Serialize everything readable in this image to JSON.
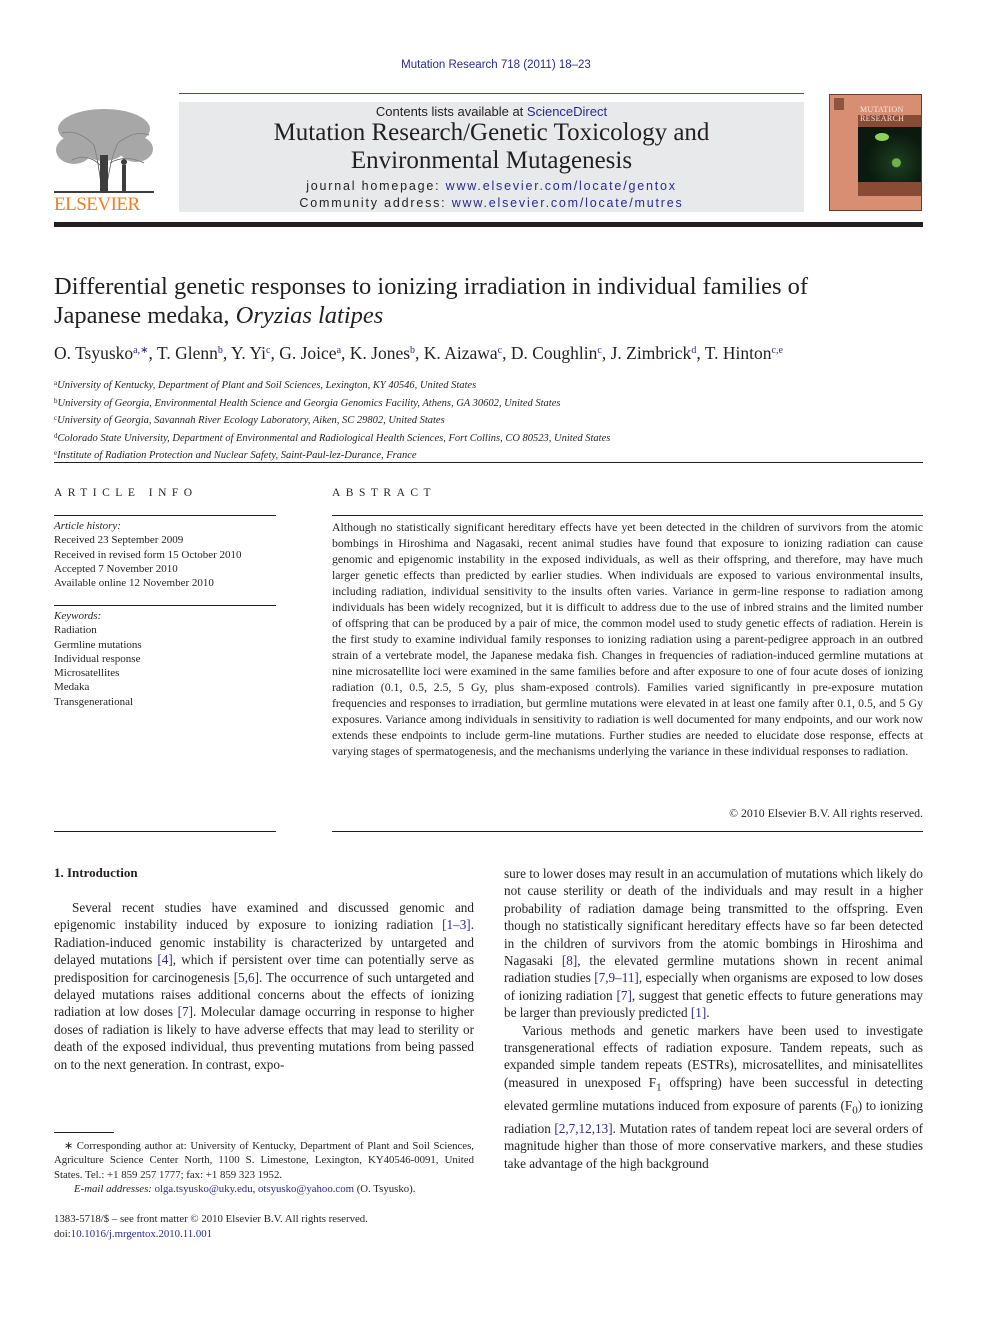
{
  "citation": "Mutation Research 718 (2011) 18–23",
  "header": {
    "publisher_logo_text": "ELSEVIER",
    "contents_prefix": "Contents lists available at ",
    "contents_link": "ScienceDirect",
    "journal_title_line1": "Mutation Research/Genetic Toxicology and",
    "journal_title_line2": "Environmental Mutagenesis",
    "homepage_label": "journal homepage: ",
    "homepage_url": "www.elsevier.com/locate/gentox",
    "community_label": "Community address: ",
    "community_url": "www.elsevier.com/locate/mutres",
    "cover_title_line1": "MUTATION",
    "cover_title_line2": "RESEARCH",
    "colors": {
      "elsevier_orange": "#f07f1f",
      "link_blue": "#2a2a8c",
      "banner_gray": "#e8e9ea",
      "cover_salmon": "#d88e72"
    }
  },
  "article": {
    "title_line1": "Differential genetic responses to ionizing irradiation in individual families of",
    "title_line2_plain": "Japanese medaka, ",
    "title_line2_italic": "Oryzias latipes",
    "authors": [
      {
        "name": "O. Tsyusko",
        "sup": "a,∗"
      },
      {
        "name": "T. Glenn",
        "sup": "b"
      },
      {
        "name": "Y. Yi",
        "sup": "c"
      },
      {
        "name": "G. Joice",
        "sup": "a"
      },
      {
        "name": "K. Jones",
        "sup": "b"
      },
      {
        "name": "K. Aizawa",
        "sup": "c"
      },
      {
        "name": "D. Coughlin",
        "sup": "c"
      },
      {
        "name": "J. Zimbrick",
        "sup": "d"
      },
      {
        "name": "T. Hinton",
        "sup": "c,e"
      }
    ],
    "affiliations": [
      {
        "key": "a",
        "text": "University of Kentucky, Department of Plant and Soil Sciences, Lexington, KY 40546, United States"
      },
      {
        "key": "b",
        "text": "University of Georgia, Environmental Health Science and Georgia Genomics Facility, Athens, GA 30602, United States"
      },
      {
        "key": "c",
        "text": "University of Georgia, Savannah River Ecology Laboratory, Aiken, SC 29802, United States"
      },
      {
        "key": "d",
        "text": "Colorado State University, Department of Environmental and Radiological Health Sciences, Fort Collins, CO 80523, United States"
      },
      {
        "key": "e",
        "text": "Institute of Radiation Protection and Nuclear Safety, Saint-Paul-lez-Durance, France"
      }
    ]
  },
  "article_info": {
    "heading": "ARTICLE INFO",
    "history_label": "Article history:",
    "history": [
      "Received 23 September 2009",
      "Received in revised form 15 October 2010",
      "Accepted 7 November 2010",
      "Available online 12 November 2010"
    ],
    "keywords_label": "Keywords:",
    "keywords": [
      "Radiation",
      "Germline mutations",
      "Individual response",
      "Microsatellites",
      "Medaka",
      "Transgenerational"
    ]
  },
  "abstract": {
    "heading": "ABSTRACT",
    "text": "Although no statistically significant hereditary effects have yet been detected in the children of survivors from the atomic bombings in Hiroshima and Nagasaki, recent animal studies have found that exposure to ionizing radiation can cause genomic and epigenomic instability in the exposed individuals, as well as their offspring, and therefore, may have much larger genetic effects than predicted by earlier studies. When individuals are exposed to various environmental insults, including radiation, individual sensitivity to the insults often varies. Variance in germ-line response to radiation among individuals has been widely recognized, but it is difficult to address due to the use of inbred strains and the limited number of offspring that can be produced by a pair of mice, the common model used to study genetic effects of radiation. Herein is the first study to examine individual family responses to ionizing radiation using a parent-pedigree approach in an outbred strain of a vertebrate model, the Japanese medaka fish. Changes in frequencies of radiation-induced germline mutations at nine microsatellite loci were examined in the same families before and after exposure to one of four acute doses of ionizing radiation (0.1, 0.5, 2.5, 5 Gy, plus sham-exposed controls). Families varied significantly in pre-exposure mutation frequencies and responses to irradiation, but germline mutations were elevated in at least one family after 0.1, 0.5, and 5 Gy exposures. Variance among individuals in sensitivity to radiation is well documented for many endpoints, and our work now extends these endpoints to include germ-line mutations. Further studies are needed to elucidate dose response, effects at varying stages of spermatogenesis, and the mechanisms underlying the variance in these individual responses to radiation.",
    "copyright": "© 2010 Elsevier B.V. All rights reserved."
  },
  "body": {
    "section_heading": "1.  Introduction",
    "left_para": [
      {
        "t": "Several recent studies have examined and discussed genomic and epigenomic instability induced by exposure to ionizing radiation "
      },
      {
        "ref": "[1–3]"
      },
      {
        "t": ". Radiation-induced genomic instability is characterized by untargeted and delayed mutations "
      },
      {
        "ref": "[4]"
      },
      {
        "t": ", which if persistent over time can potentially serve as predisposition for carcinogenesis "
      },
      {
        "ref": "[5,6]"
      },
      {
        "t": ". The occurrence of such untargeted and delayed mutations raises additional concerns about the effects of ionizing radiation at low doses "
      },
      {
        "ref": "[7]"
      },
      {
        "t": ". Molecular damage occurring in response to higher doses of radiation is likely to have adverse effects that may lead to sterility or death of the exposed individual, thus preventing mutations from being passed on to the next generation. In contrast, expo-"
      }
    ],
    "right_para1": [
      {
        "t": "sure to lower doses may result in an accumulation of mutations which likely do not cause sterility or death of the individuals and may result in a higher probability of radiation damage being transmitted to the offspring. Even though no statistically significant hereditary effects have so far been detected in the children of survivors from the atomic bombings in Hiroshima and Nagasaki "
      },
      {
        "ref": "[8]"
      },
      {
        "t": ", the elevated germline mutations shown in recent animal radiation studies "
      },
      {
        "ref": "[7,9–11]"
      },
      {
        "t": ", especially when organisms are exposed to low doses of ionizing radiation "
      },
      {
        "ref": "[7]"
      },
      {
        "t": ", suggest that genetic effects to future generations may be larger than previously predicted "
      },
      {
        "ref": "[1]"
      },
      {
        "t": "."
      }
    ],
    "right_para2": [
      {
        "t": "Various methods and genetic markers have been used to investigate transgenerational effects of radiation exposure. Tandem repeats, such as expanded simple tandem repeats (ESTRs), microsatellites, and minisatellites (measured in unexposed F"
      },
      {
        "sub": "1"
      },
      {
        "t": " offspring) have been successful in detecting elevated germline mutations induced from exposure of parents (F"
      },
      {
        "sub": "0"
      },
      {
        "t": ") to ionizing radiation "
      },
      {
        "ref": "[2,7,12,13]"
      },
      {
        "t": ". Mutation rates of tandem repeat loci are several orders of magnitude higher than those of more conservative markers, and these studies take advantage of the high background"
      }
    ]
  },
  "footnote": {
    "corresponding": "∗ Corresponding author at: University of Kentucky, Department of Plant and Soil Sciences, Agriculture Science Center North, 1100 S. Limestone, Lexington, KY40546-0091, United States. Tel.: +1 859 257 1777; fax: +1 859 323 1952.",
    "email_label": "E-mail addresses: ",
    "email1": "olga.tsyusko@uky.edu",
    "email_sep": ", ",
    "email2": "otsyusko@yahoo.com",
    "email_suffix": " (O. Tsyusko)."
  },
  "front_matter": {
    "issn_line": "1383-5718/$ – see front matter © 2010 Elsevier B.V. All rights reserved.",
    "doi_label": "doi:",
    "doi": "10.1016/j.mrgentox.2010.11.001"
  }
}
